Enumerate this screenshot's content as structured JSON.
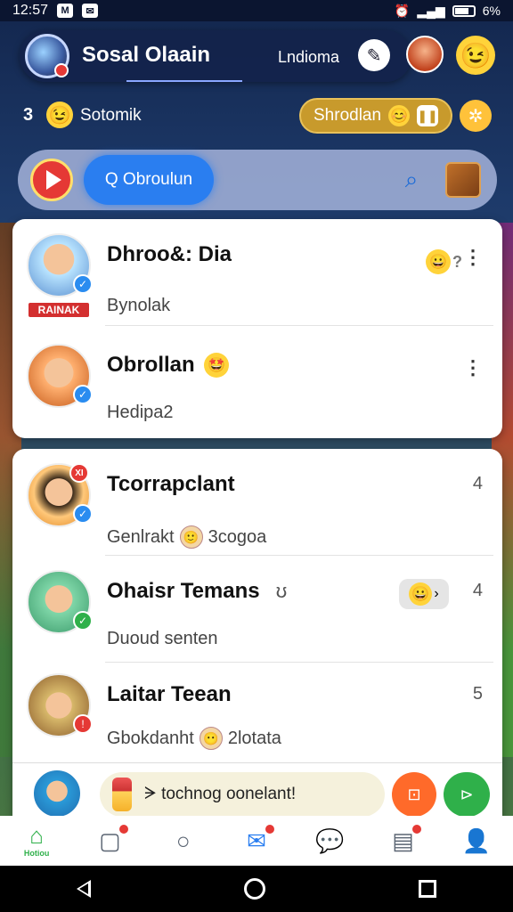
{
  "status_bar": {
    "time": "12:57",
    "icon1": "M",
    "icon2": "✉",
    "battery_text": "6%"
  },
  "header": {
    "title": "Sosal Olaain",
    "link": "Lndioma",
    "compose_icon": "compose-icon",
    "emoji": "😉"
  },
  "row2": {
    "number": "3",
    "emoji": "😉",
    "label": "Sotomik",
    "status_pill": "Shrodlan",
    "pill_emoji": "😊",
    "pill_icon": "❚❚",
    "settings_icon": "✲"
  },
  "search": {
    "chip_label": "Q Obroulun",
    "search_icon": "🔍"
  },
  "chats": [
    {
      "name": "Dhroo&: Dia",
      "preview": "Bynolak",
      "tag": "RAINAK",
      "reaction": "😀",
      "reaction_extra": "?",
      "more": "⋮",
      "avatar_colors": [
        "#b9e4ff",
        "#5a8fd0"
      ]
    },
    {
      "name": "Obrollan",
      "name_emoji": "🤩",
      "preview": "Hedipa2",
      "more": "⋮",
      "avatar_colors": [
        "#ffb070",
        "#c55a1a"
      ]
    },
    {
      "name": "Tcorrapclant",
      "preview": "Genlrakt",
      "preview_emoji": "🙂",
      "preview_suffix": "3cogoa",
      "badge": "XI",
      "count": "4",
      "avatar_colors": [
        "#ffc87a",
        "#e0831e"
      ]
    },
    {
      "name": "Ohaisr Temans",
      "name_icon": "ʊ",
      "preview": "Duoud senten",
      "reaction": "😀",
      "reaction_extra": "›",
      "count": "4",
      "avatar_colors": [
        "#7fd6a8",
        "#3a9a6a"
      ]
    },
    {
      "name": "Laitar Teean",
      "preview": "Gbokdanht",
      "preview_emoji": "😶",
      "preview_suffix": "2lotata",
      "count": "5",
      "avatar_colors": [
        "#d7b86a",
        "#8a5a2a"
      ]
    }
  ],
  "composer": {
    "placeholder": "ᗒ tochnog oonelant!",
    "action1_icon": "⊡",
    "action2_icon": "⊳"
  },
  "bottom_nav": [
    {
      "icon": "⌂",
      "label": "Hotiou",
      "active": true
    },
    {
      "icon": "▢",
      "label": "",
      "badge": true
    },
    {
      "icon": "○",
      "label": ""
    },
    {
      "icon": "✉",
      "label": "",
      "badge": true
    },
    {
      "icon": "💬",
      "label": ""
    },
    {
      "icon": "▤",
      "label": "",
      "badge": true
    },
    {
      "icon": "👤",
      "label": ""
    }
  ],
  "colors": {
    "accent_blue": "#2a7ef0",
    "accent_green": "#2fb04a",
    "pill_gold": "#c89a2c",
    "alert_red": "#e53935"
  }
}
